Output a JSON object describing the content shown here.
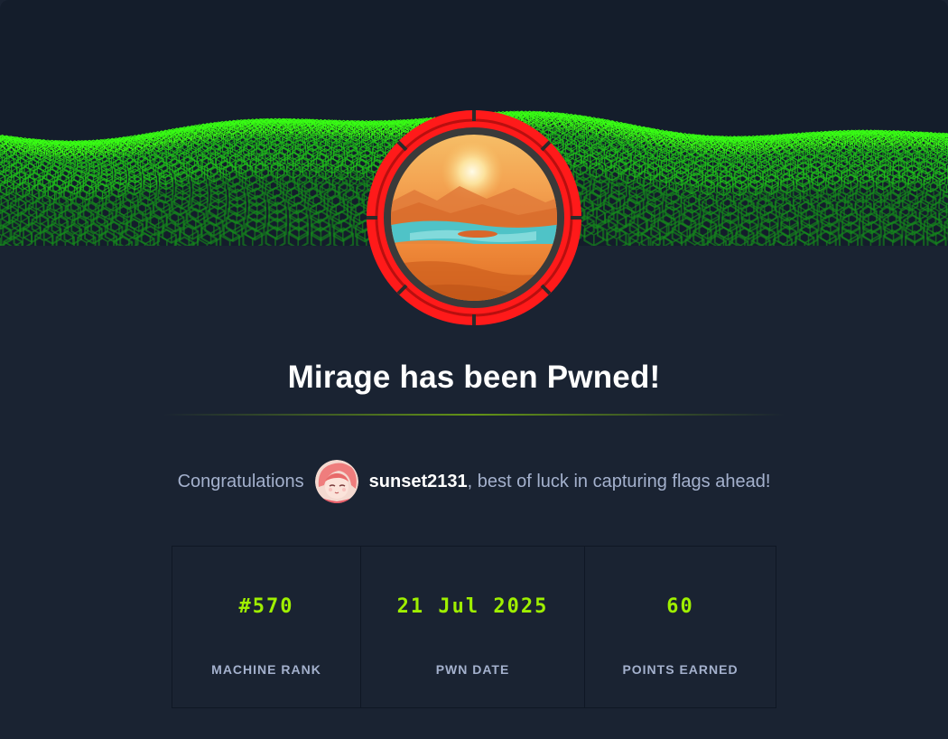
{
  "colors": {
    "background": "#1a2332",
    "banner": "#141d2b",
    "accent_green": "#9fef00",
    "ring_red": "#ff1a1a",
    "text_muted": "#a4b1cd",
    "text_white": "#ffffff"
  },
  "banner": {
    "icon": "hexagon-grid-wave-icon"
  },
  "machine": {
    "avatar_icon": "mirage-desert-lake-icon"
  },
  "title": "Mirage has been Pwned!",
  "congrats": {
    "lead": "Congratulations",
    "user_avatar_icon": "anime-user-avatar-icon",
    "username": "sunset2131",
    "tail": ", best of luck in capturing flags ahead!"
  },
  "stats": [
    {
      "value": "#570",
      "label": "MACHINE RANK"
    },
    {
      "value": "21 Jul 2025",
      "label": "PWN DATE"
    },
    {
      "value": "60",
      "label": "POINTS EARNED"
    }
  ]
}
